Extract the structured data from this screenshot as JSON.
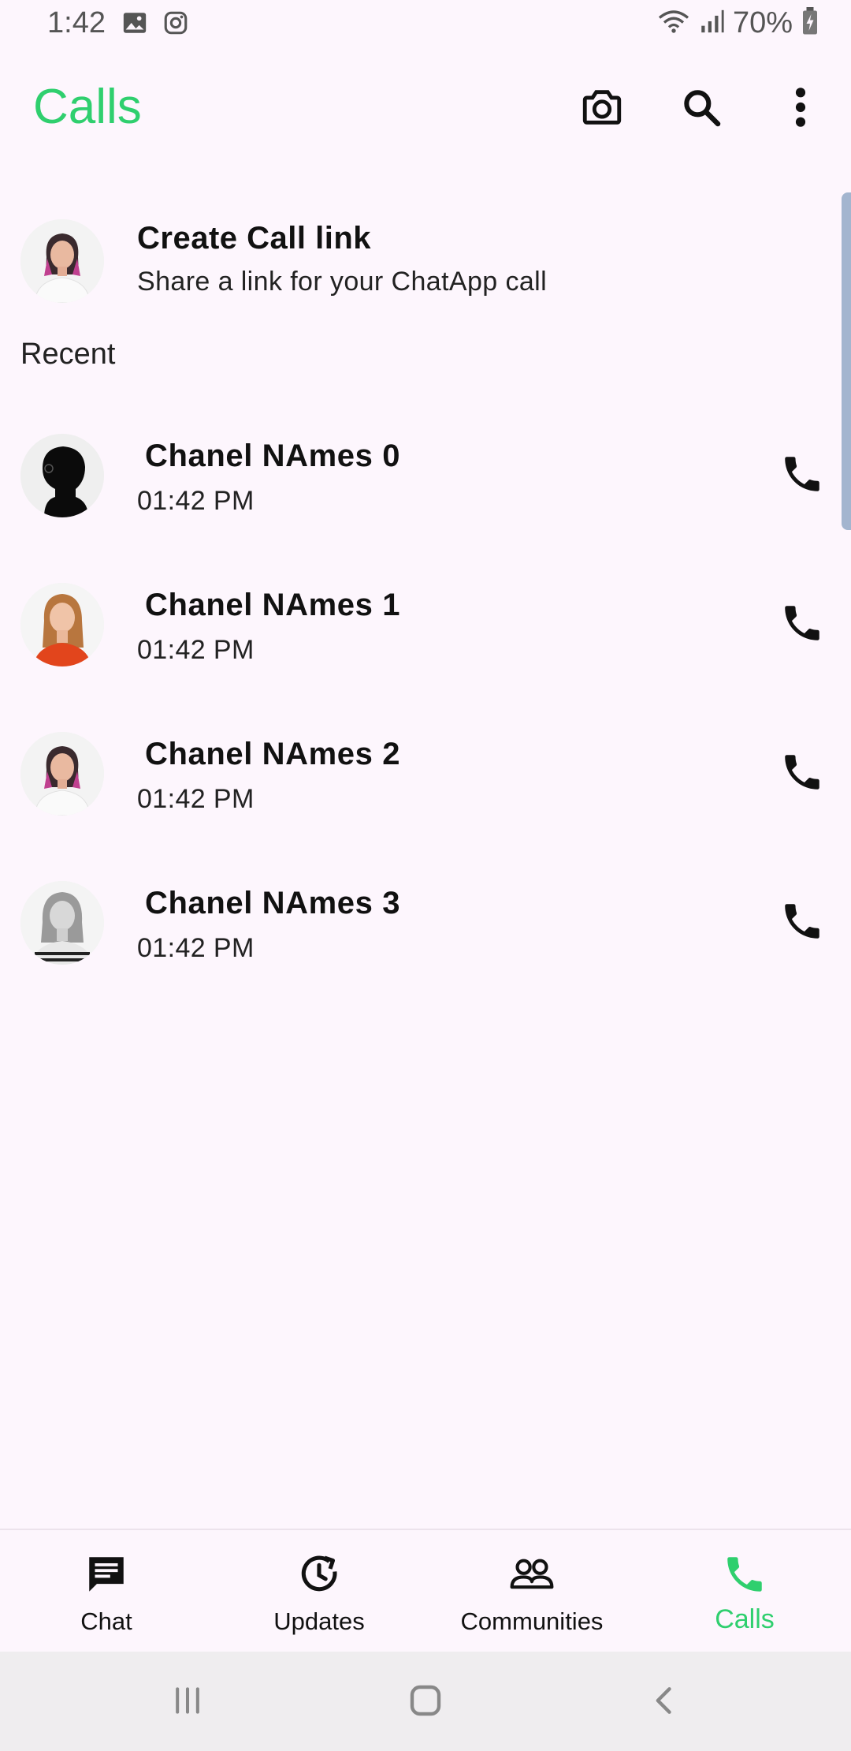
{
  "status_bar": {
    "time": "1:42",
    "battery": "70%",
    "icons": [
      "image-icon",
      "instagram-icon",
      "wifi-icon",
      "signal-icon",
      "battery-charging-icon"
    ]
  },
  "app_bar": {
    "title": "Calls",
    "title_color": "#2fcf6e",
    "actions": [
      "camera-icon",
      "search-icon",
      "more-vert-icon"
    ]
  },
  "create_link": {
    "title": "Create Call link",
    "subtitle": "Share a link for your ChatApp call"
  },
  "recent_label": "Recent",
  "calls": [
    {
      "name": "Chanel NAmes 0",
      "time": "01:42 PM"
    },
    {
      "name": "Chanel NAmes 1",
      "time": "01:42 PM"
    },
    {
      "name": "Chanel NAmes 2",
      "time": "01:42 PM"
    },
    {
      "name": "Chanel NAmes 3",
      "time": "01:42 PM"
    }
  ],
  "bottom_nav": {
    "items": [
      {
        "label": "Chat",
        "icon": "chat-icon"
      },
      {
        "label": "Updates",
        "icon": "updates-icon"
      },
      {
        "label": "Communities",
        "icon": "communities-icon"
      },
      {
        "label": "Calls",
        "icon": "phone-icon"
      }
    ],
    "active": "Calls",
    "active_color": "#2fcf6e"
  },
  "system_nav": [
    "recents-icon",
    "home-icon",
    "back-icon"
  ]
}
